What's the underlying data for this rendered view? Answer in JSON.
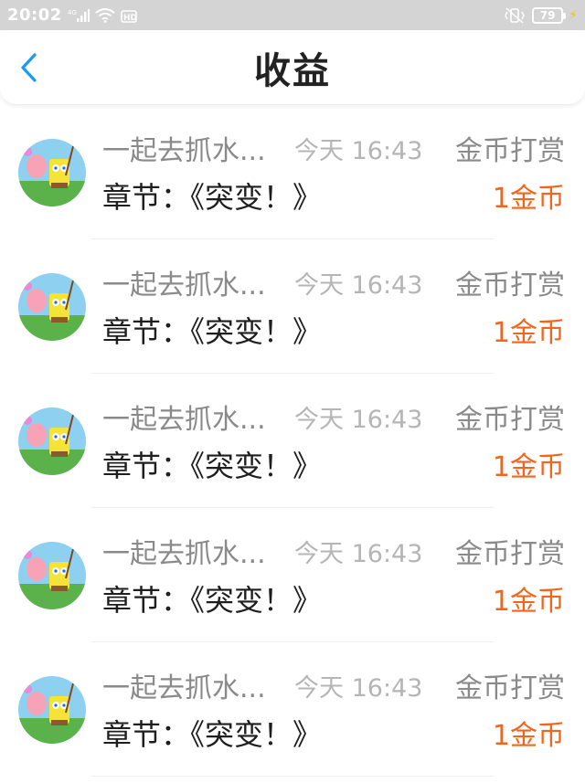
{
  "status_bar": {
    "time": "20:02",
    "network": "4G",
    "hd": "HD",
    "battery": "79"
  },
  "header": {
    "title": "收益",
    "back_icon": "chevron-left-icon"
  },
  "colors": {
    "accent": "#1a9bf0",
    "amount": "#f2651b",
    "muted": "#8a8a8a",
    "timestamp": "#b5b5b5"
  },
  "items": [
    {
      "name": "一起去抓水...",
      "time": "今天 16:43",
      "type": "金币打赏",
      "chapter": "章节：《突变！》",
      "amount": "1金币"
    },
    {
      "name": "一起去抓水...",
      "time": "今天 16:43",
      "type": "金币打赏",
      "chapter": "章节：《突变！》",
      "amount": "1金币"
    },
    {
      "name": "一起去抓水...",
      "time": "今天 16:43",
      "type": "金币打赏",
      "chapter": "章节：《突变！》",
      "amount": "1金币"
    },
    {
      "name": "一起去抓水...",
      "time": "今天 16:43",
      "type": "金币打赏",
      "chapter": "章节：《突变！》",
      "amount": "1金币"
    },
    {
      "name": "一起去抓水...",
      "time": "今天 16:43",
      "type": "金币打赏",
      "chapter": "章节：《突变！》",
      "amount": "1金币"
    }
  ]
}
